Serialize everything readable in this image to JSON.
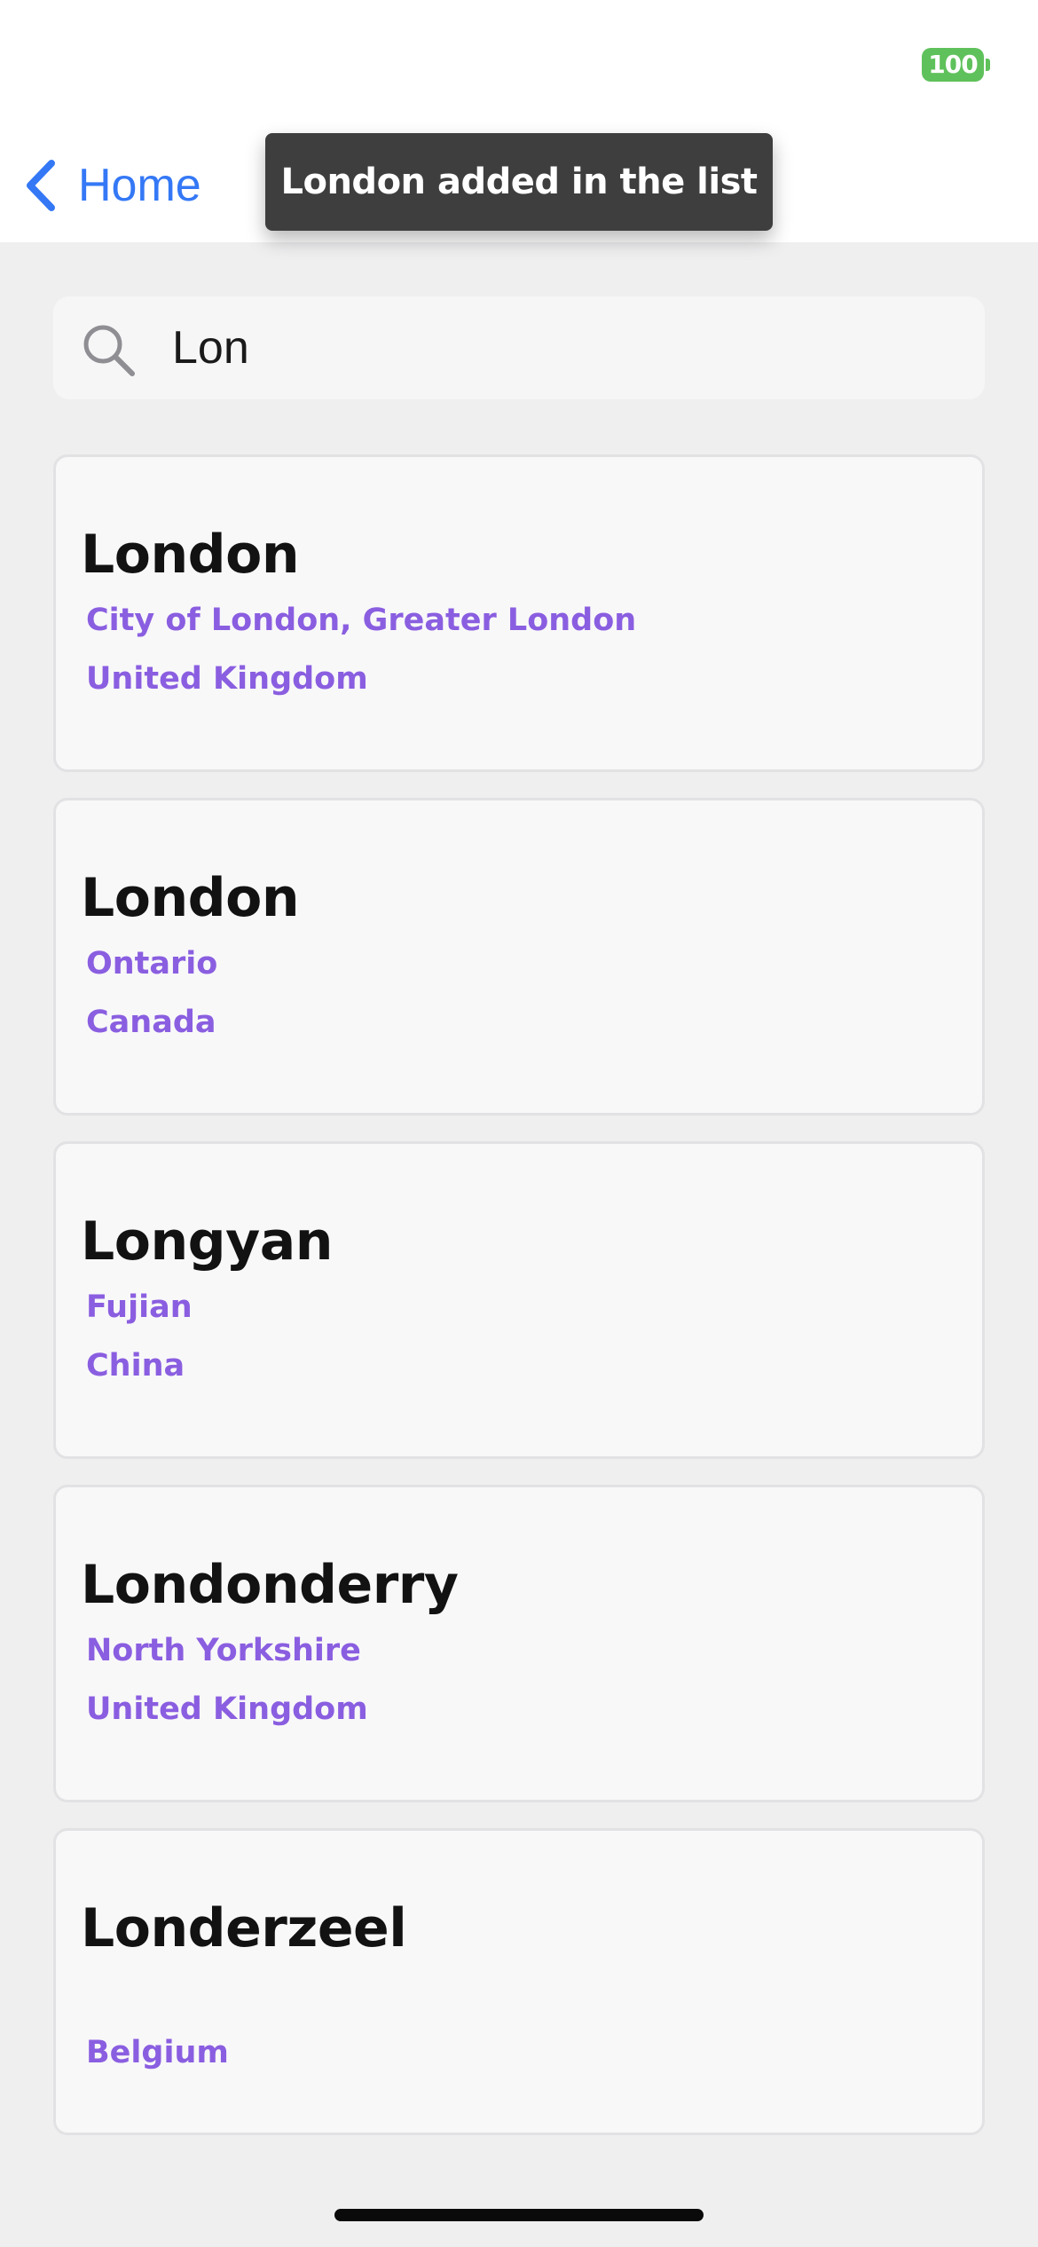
{
  "status_bar": {
    "battery_level": "100",
    "battery_color": "#5fc15b"
  },
  "nav": {
    "back_label": "Home",
    "back_icon": "chevron-left-icon",
    "accent_color": "#3478f6"
  },
  "toast": {
    "message": "London added in the list"
  },
  "search": {
    "icon": "search-icon",
    "value": "Lon"
  },
  "results": [
    {
      "name": "London",
      "region": "City of London, Greater London",
      "country": "United Kingdom"
    },
    {
      "name": "London",
      "region": "Ontario",
      "country": "Canada"
    },
    {
      "name": "Longyan",
      "region": "Fujian",
      "country": "China"
    },
    {
      "name": "Londonderry",
      "region": "North Yorkshire",
      "country": "United Kingdom"
    },
    {
      "name": "Londerzeel",
      "region": "",
      "country": "Belgium"
    }
  ],
  "colors": {
    "region_text": "#8a5ee0",
    "card_background": "#f8f8f9"
  }
}
